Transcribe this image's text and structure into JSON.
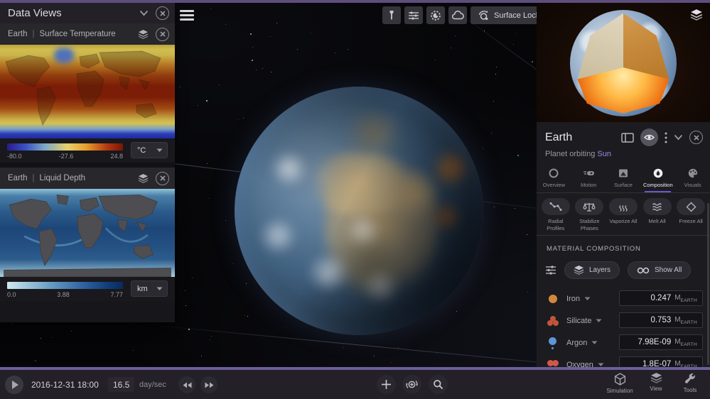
{
  "colors": {
    "accent_purple": "#6c58c8",
    "border_purple": "#5d4e7e",
    "link_purple": "#9b8ce8",
    "temp_scale_ends": [
      "#2b1a8e",
      "#7a1505"
    ],
    "depth_scale_ends": [
      "#cfe8ef",
      "#0a2a5e"
    ]
  },
  "left_panel": {
    "title": "Data Views",
    "cards": [
      {
        "target": "Earth",
        "sep": "|",
        "metric": "Surface Temperature",
        "scale_min": "-80.0",
        "scale_mid": "-27.6",
        "scale_max": "24.8",
        "unit": "°C"
      },
      {
        "target": "Earth",
        "sep": "|",
        "metric": "Liquid Depth",
        "scale_min": "0.0",
        "scale_mid": "3.88",
        "scale_max": "7.77",
        "unit": "km"
      }
    ]
  },
  "viewport": {
    "surface_lock_label": "Surface Lock"
  },
  "right_panel": {
    "title": "Earth",
    "subtitle_prefix": "Planet orbiting ",
    "subtitle_link": "Sun",
    "active_tab": "Composition",
    "tabs": [
      {
        "label": "Overview"
      },
      {
        "label": "Motion"
      },
      {
        "label": "Surface"
      },
      {
        "label": "Composition"
      },
      {
        "label": "Visuals"
      }
    ],
    "actions": [
      {
        "label": "Radial Profiles"
      },
      {
        "label": "Stabilize Phases"
      },
      {
        "label": "Vaporize All"
      },
      {
        "label": "Melt All"
      },
      {
        "label": "Freeze All"
      }
    ],
    "section_title": "MATERIAL COMPOSITION",
    "layers_button": "Layers",
    "show_all_button": "Show All",
    "materials": [
      {
        "name": "Iron",
        "value": "0.247",
        "unit": "M",
        "unit_sub": "EARTH",
        "color": "#d4873c"
      },
      {
        "name": "Silicate",
        "value": "0.753",
        "unit": "M",
        "unit_sub": "EARTH",
        "color": "#c2553a"
      },
      {
        "name": "Argon",
        "value": "7.98E-09",
        "unit": "M",
        "unit_sub": "EARTH",
        "color": "#5b97d4"
      },
      {
        "name": "Oxygen",
        "value": "1.8E-07",
        "unit": "M",
        "unit_sub": "EARTH",
        "color": "#d05848"
      }
    ]
  },
  "bottom_bar": {
    "datetime": "2016-12-31 18:00",
    "speed_value": "16.5",
    "speed_unit": "day/sec",
    "menus": [
      {
        "label": "Simulation"
      },
      {
        "label": "View"
      },
      {
        "label": "Tools"
      }
    ]
  }
}
